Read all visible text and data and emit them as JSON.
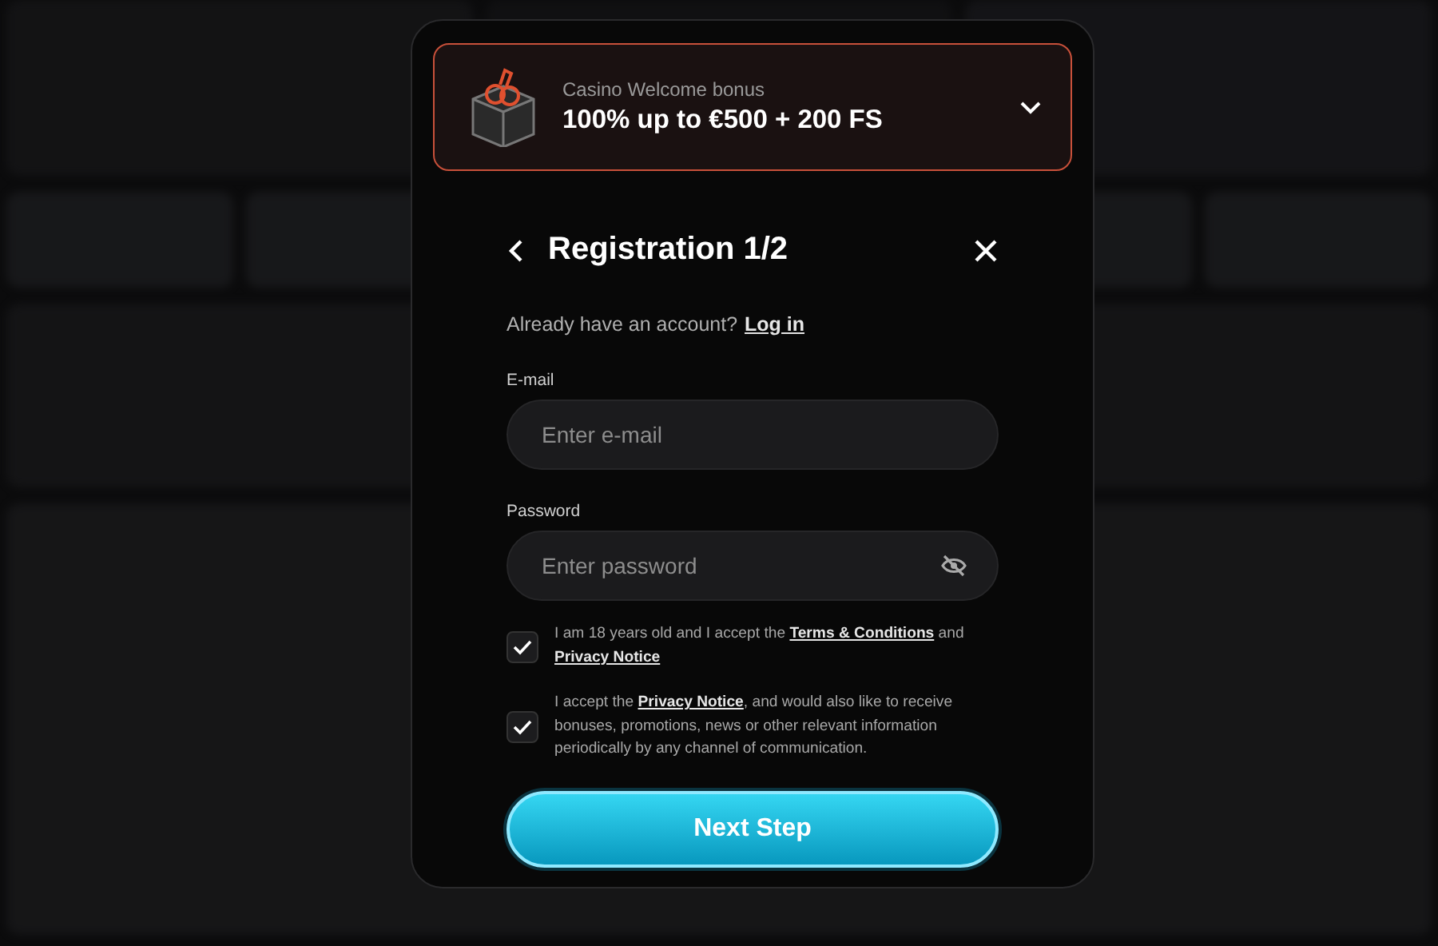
{
  "promo": {
    "caption": "Casino Welcome bonus",
    "title": "100% up to €500 + 200 FS",
    "expanded": false
  },
  "dialog": {
    "title": "Registration 1/2"
  },
  "login_prompt": {
    "text": "Already have an account?",
    "link": "Log in"
  },
  "fields": [
    {
      "kind": "email",
      "label": "E-mail",
      "placeholder": "Enter e-mail"
    },
    {
      "kind": "password",
      "label": "Password",
      "placeholder": "Enter password"
    }
  ],
  "consents": [
    {
      "checked": true,
      "parts": [
        {
          "kind": "text",
          "text": "I am 18 years old and I accept the "
        },
        {
          "kind": "link",
          "text": "Terms & Conditions"
        },
        {
          "kind": "text",
          "text": " and "
        },
        {
          "kind": "link",
          "text": "Privacy Notice"
        }
      ]
    },
    {
      "checked": true,
      "parts": [
        {
          "kind": "text",
          "text": "I accept the "
        },
        {
          "kind": "link",
          "text": "Privacy Notice"
        },
        {
          "kind": "text",
          "text": ", and would also like to receive bonuses, promotions, news or other relevant information periodically by any channel of communication."
        }
      ]
    }
  ],
  "submit": {
    "label": "Next Step"
  }
}
